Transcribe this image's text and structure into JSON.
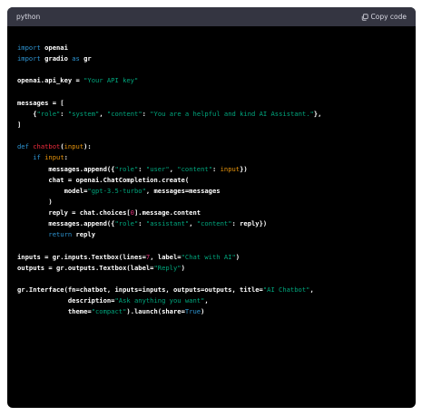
{
  "code_block": {
    "language": "python",
    "copy_label": "Copy code",
    "copy_icon": "clipboard-icon",
    "colors": {
      "background": "#000000",
      "header": "#343541",
      "keyword": "#2e95d3",
      "string": "#00a67d",
      "function_name": "#f22c3d",
      "number": "#df3079",
      "builtin": "#e9950c",
      "text": "#ffffff"
    },
    "lines": [
      [
        {
          "t": "kw",
          "v": "import"
        },
        {
          "t": "p",
          "v": " openai"
        }
      ],
      [
        {
          "t": "kw",
          "v": "import"
        },
        {
          "t": "p",
          "v": " gradio "
        },
        {
          "t": "kw",
          "v": "as"
        },
        {
          "t": "p",
          "v": " gr"
        }
      ],
      [],
      [
        {
          "t": "p",
          "v": "openai.api_key = "
        },
        {
          "t": "str",
          "v": "\"Your API key\""
        }
      ],
      [],
      [
        {
          "t": "p",
          "v": "messages = ["
        }
      ],
      [
        {
          "t": "p",
          "v": "    {"
        },
        {
          "t": "str",
          "v": "\"role\""
        },
        {
          "t": "p",
          "v": ": "
        },
        {
          "t": "str",
          "v": "\"system\""
        },
        {
          "t": "p",
          "v": ", "
        },
        {
          "t": "str",
          "v": "\"content\""
        },
        {
          "t": "p",
          "v": ": "
        },
        {
          "t": "str",
          "v": "\"You are a helpful and kind AI Assistant.\""
        },
        {
          "t": "p",
          "v": "},"
        }
      ],
      [
        {
          "t": "p",
          "v": "]"
        }
      ],
      [],
      [
        {
          "t": "kw",
          "v": "def"
        },
        {
          "t": "p",
          "v": " "
        },
        {
          "t": "fn",
          "v": "chatbot"
        },
        {
          "t": "p",
          "v": "("
        },
        {
          "t": "bi",
          "v": "input"
        },
        {
          "t": "p",
          "v": "):"
        }
      ],
      [
        {
          "t": "p",
          "v": "    "
        },
        {
          "t": "kw",
          "v": "if"
        },
        {
          "t": "p",
          "v": " "
        },
        {
          "t": "bi",
          "v": "input"
        },
        {
          "t": "p",
          "v": ":"
        }
      ],
      [
        {
          "t": "p",
          "v": "        messages.append({"
        },
        {
          "t": "str",
          "v": "\"role\""
        },
        {
          "t": "p",
          "v": ": "
        },
        {
          "t": "str",
          "v": "\"user\""
        },
        {
          "t": "p",
          "v": ", "
        },
        {
          "t": "str",
          "v": "\"content\""
        },
        {
          "t": "p",
          "v": ": "
        },
        {
          "t": "bi",
          "v": "input"
        },
        {
          "t": "p",
          "v": "})"
        }
      ],
      [
        {
          "t": "p",
          "v": "        chat = openai.ChatCompletion.create("
        }
      ],
      [
        {
          "t": "p",
          "v": "            model="
        },
        {
          "t": "str",
          "v": "\"gpt-3.5-turbo\""
        },
        {
          "t": "p",
          "v": ", messages=messages"
        }
      ],
      [
        {
          "t": "p",
          "v": "        )"
        }
      ],
      [
        {
          "t": "p",
          "v": "        reply = chat.choices["
        },
        {
          "t": "num",
          "v": "0"
        },
        {
          "t": "p",
          "v": "].message.content"
        }
      ],
      [
        {
          "t": "p",
          "v": "        messages.append({"
        },
        {
          "t": "str",
          "v": "\"role\""
        },
        {
          "t": "p",
          "v": ": "
        },
        {
          "t": "str",
          "v": "\"assistant\""
        },
        {
          "t": "p",
          "v": ", "
        },
        {
          "t": "str",
          "v": "\"content\""
        },
        {
          "t": "p",
          "v": ": reply})"
        }
      ],
      [
        {
          "t": "p",
          "v": "        "
        },
        {
          "t": "kw",
          "v": "return"
        },
        {
          "t": "p",
          "v": " reply"
        }
      ],
      [],
      [
        {
          "t": "p",
          "v": "inputs = gr.inputs.Textbox(lines="
        },
        {
          "t": "num",
          "v": "7"
        },
        {
          "t": "p",
          "v": ", label="
        },
        {
          "t": "str",
          "v": "\"Chat with AI\""
        },
        {
          "t": "p",
          "v": ")"
        }
      ],
      [
        {
          "t": "p",
          "v": "outputs = gr.outputs.Textbox(label="
        },
        {
          "t": "str",
          "v": "\"Reply\""
        },
        {
          "t": "p",
          "v": ")"
        }
      ],
      [],
      [
        {
          "t": "p",
          "v": "gr.Interface(fn=chatbot, inputs=inputs, outputs=outputs, title="
        },
        {
          "t": "str",
          "v": "\"AI Chatbot\""
        },
        {
          "t": "p",
          "v": ","
        }
      ],
      [
        {
          "t": "p",
          "v": "             description="
        },
        {
          "t": "str",
          "v": "\"Ask anything you want\""
        },
        {
          "t": "p",
          "v": ","
        }
      ],
      [
        {
          "t": "p",
          "v": "             theme="
        },
        {
          "t": "str",
          "v": "\"compact\""
        },
        {
          "t": "p",
          "v": ").launch(share="
        },
        {
          "t": "kw",
          "v": "True"
        },
        {
          "t": "p",
          "v": ")"
        }
      ]
    ]
  }
}
